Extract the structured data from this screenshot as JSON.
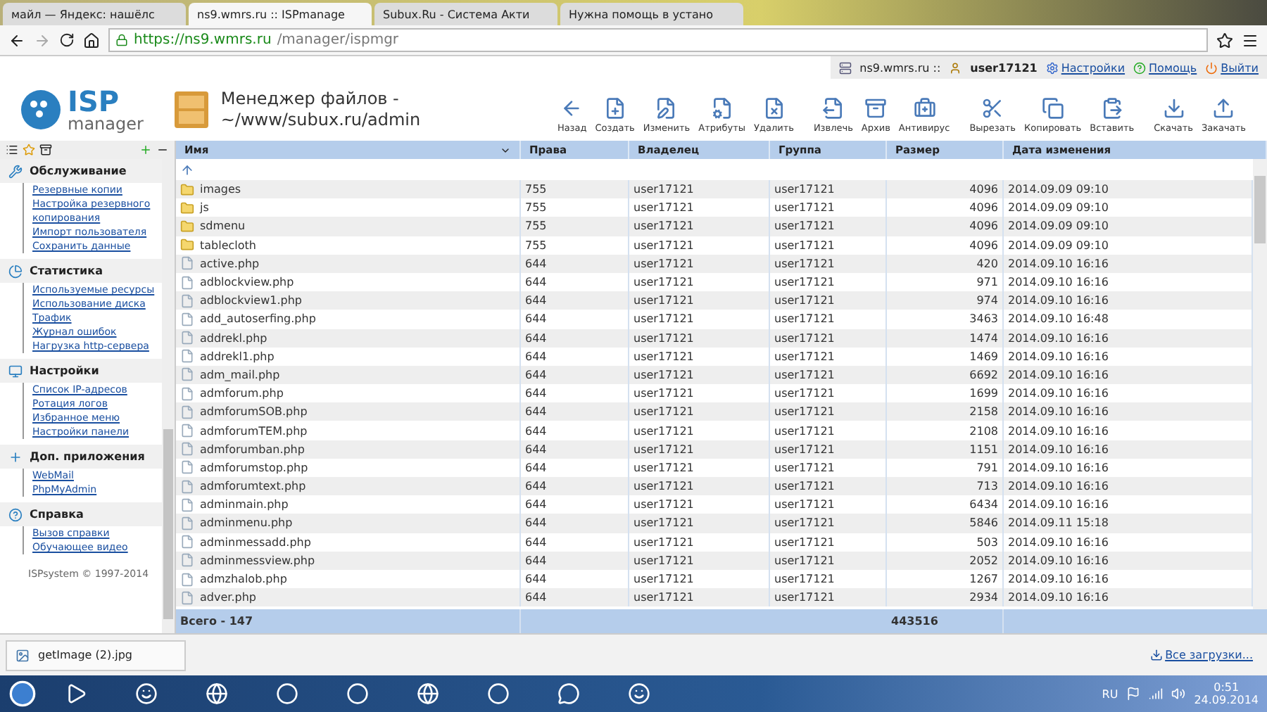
{
  "browser": {
    "tabs": [
      {
        "title": "майл — Яндекс: нашёлс",
        "selected": false
      },
      {
        "title": "ns9.wmrs.ru :: ISPmanage",
        "selected": true
      },
      {
        "title": "Subux.Ru - Система Акти",
        "selected": false
      },
      {
        "title": "Нужна помощь в устано",
        "selected": false
      }
    ],
    "url_host": "https://ns9.wmrs.ru",
    "url_path": "/manager/ispmgr"
  },
  "user_bar": {
    "server": "ns9.wmrs.ru ::",
    "user": "user17121",
    "links": [
      "Настройки",
      "Помощь",
      "Выйти"
    ]
  },
  "logo": {
    "mark": "ISP",
    "word": "manager"
  },
  "title": {
    "line1": "Менеджер файлов -",
    "line2": "~/www/subux.ru/admin"
  },
  "toolbar": [
    {
      "label": "Назад",
      "kind": "back"
    },
    {
      "label": "Создать",
      "kind": "new"
    },
    {
      "label": "Изменить",
      "kind": "edit"
    },
    {
      "label": "Атрибуты",
      "kind": "attr"
    },
    {
      "label": "Удалить",
      "kind": "delete"
    },
    {
      "label": "Извлечь",
      "kind": "extract"
    },
    {
      "label": "Архив",
      "kind": "archive"
    },
    {
      "label": "Антивирус",
      "kind": "antivirus"
    },
    {
      "label": "Вырезать",
      "kind": "cut"
    },
    {
      "label": "Копировать",
      "kind": "copy"
    },
    {
      "label": "Вставить",
      "kind": "paste"
    },
    {
      "label": "Скачать",
      "kind": "download"
    },
    {
      "label": "Закачать",
      "kind": "upload"
    }
  ],
  "sidebar": {
    "sections": [
      {
        "title": "Обслуживание",
        "kind": "service",
        "items": [
          "Резервные копии",
          "Настройка резервного копирования",
          "Импорт пользователя",
          "Сохранить данные"
        ]
      },
      {
        "title": "Статистика",
        "kind": "stats",
        "items": [
          "Используемые ресурсы",
          "Использование диска",
          "Трафик",
          "Журнал ошибок",
          "Нагрузка http-сервера"
        ]
      },
      {
        "title": "Настройки",
        "kind": "settings",
        "items": [
          "Список IP-адресов",
          "Ротация логов",
          "Избранное меню",
          "Настройки панели"
        ]
      },
      {
        "title": "Доп. приложения",
        "kind": "apps",
        "items": [
          "WebMail",
          "PhpMyAdmin"
        ]
      },
      {
        "title": "Справка",
        "kind": "help",
        "items": [
          "Вызов справки",
          "Обучающее видео"
        ]
      }
    ],
    "footer": "ISPsystem © 1997-2014"
  },
  "table": {
    "columns": [
      "Имя",
      "Права",
      "Владелец",
      "Группа",
      "Размер",
      "Дата изменения"
    ],
    "rows": [
      {
        "kind": "folder",
        "cells": [
          "images",
          "755",
          "user17121",
          "user17121",
          "4096",
          "2014.09.09 09:10"
        ]
      },
      {
        "kind": "folder",
        "cells": [
          "js",
          "755",
          "user17121",
          "user17121",
          "4096",
          "2014.09.09 09:10"
        ]
      },
      {
        "kind": "folder",
        "cells": [
          "sdmenu",
          "755",
          "user17121",
          "user17121",
          "4096",
          "2014.09.09 09:10"
        ]
      },
      {
        "kind": "folder",
        "cells": [
          "tablecloth",
          "755",
          "user17121",
          "user17121",
          "4096",
          "2014.09.09 09:10"
        ]
      },
      {
        "kind": "file",
        "cells": [
          "active.php",
          "644",
          "user17121",
          "user17121",
          "420",
          "2014.09.10 16:16"
        ]
      },
      {
        "kind": "file",
        "cells": [
          "adblockview.php",
          "644",
          "user17121",
          "user17121",
          "971",
          "2014.09.10 16:16"
        ]
      },
      {
        "kind": "file",
        "cells": [
          "adblockview1.php",
          "644",
          "user17121",
          "user17121",
          "974",
          "2014.09.10 16:16"
        ]
      },
      {
        "kind": "file",
        "cells": [
          "add_autoserfing.php",
          "644",
          "user17121",
          "user17121",
          "3463",
          "2014.09.10 16:48"
        ]
      },
      {
        "kind": "file",
        "cells": [
          "addrekl.php",
          "644",
          "user17121",
          "user17121",
          "1474",
          "2014.09.10 16:16"
        ]
      },
      {
        "kind": "file",
        "cells": [
          "addrekl1.php",
          "644",
          "user17121",
          "user17121",
          "1469",
          "2014.09.10 16:16"
        ]
      },
      {
        "kind": "file",
        "cells": [
          "adm_mail.php",
          "644",
          "user17121",
          "user17121",
          "6692",
          "2014.09.10 16:16"
        ]
      },
      {
        "kind": "file",
        "cells": [
          "admforum.php",
          "644",
          "user17121",
          "user17121",
          "1699",
          "2014.09.10 16:16"
        ]
      },
      {
        "kind": "file",
        "cells": [
          "admforumSOB.php",
          "644",
          "user17121",
          "user17121",
          "2158",
          "2014.09.10 16:16"
        ]
      },
      {
        "kind": "file",
        "cells": [
          "admforumTEM.php",
          "644",
          "user17121",
          "user17121",
          "2108",
          "2014.09.10 16:16"
        ]
      },
      {
        "kind": "file",
        "cells": [
          "admforumban.php",
          "644",
          "user17121",
          "user17121",
          "1151",
          "2014.09.10 16:16"
        ]
      },
      {
        "kind": "file",
        "cells": [
          "admforumstop.php",
          "644",
          "user17121",
          "user17121",
          "791",
          "2014.09.10 16:16"
        ]
      },
      {
        "kind": "file",
        "cells": [
          "admforumtext.php",
          "644",
          "user17121",
          "user17121",
          "713",
          "2014.09.10 16:16"
        ]
      },
      {
        "kind": "file",
        "cells": [
          "adminmain.php",
          "644",
          "user17121",
          "user17121",
          "6434",
          "2014.09.10 16:16"
        ]
      },
      {
        "kind": "file",
        "cells": [
          "adminmenu.php",
          "644",
          "user17121",
          "user17121",
          "5846",
          "2014.09.11 15:18"
        ]
      },
      {
        "kind": "file",
        "cells": [
          "adminmessadd.php",
          "644",
          "user17121",
          "user17121",
          "503",
          "2014.09.10 16:16"
        ]
      },
      {
        "kind": "file",
        "cells": [
          "adminmessview.php",
          "644",
          "user17121",
          "user17121",
          "2052",
          "2014.09.10 16:16"
        ]
      },
      {
        "kind": "file",
        "cells": [
          "admzhalob.php",
          "644",
          "user17121",
          "user17121",
          "1267",
          "2014.09.10 16:16"
        ]
      },
      {
        "kind": "file",
        "cells": [
          "adver.php",
          "644",
          "user17121",
          "user17121",
          "2934",
          "2014.09.10 16:16"
        ]
      }
    ],
    "total_label": "Всего - 147",
    "total_size": "443516"
  },
  "download_bar": {
    "file": "getImage (2).jpg",
    "all": "Все загрузки..."
  },
  "taskbar": {
    "lang": "RU",
    "time": "0:51",
    "date": "24.09.2014"
  }
}
